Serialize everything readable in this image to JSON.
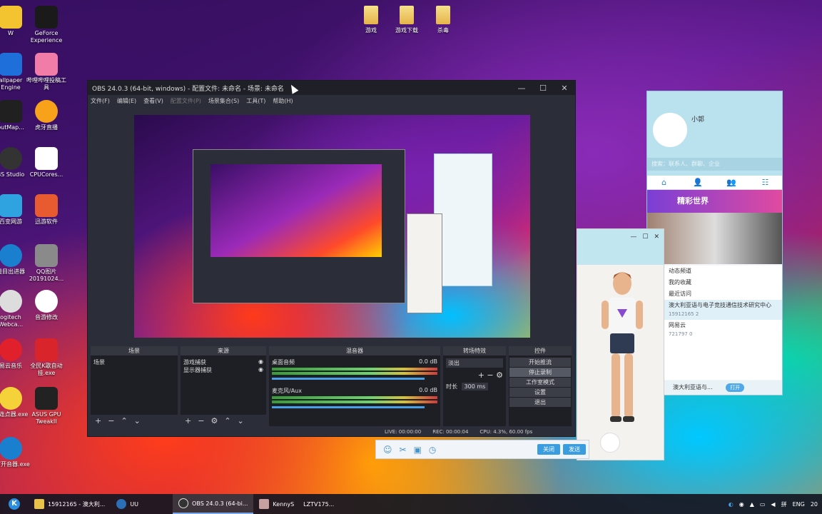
{
  "desktop": {
    "left_icons": [
      {
        "label": "W"
      },
      {
        "label": "GeForce Experience"
      },
      {
        "label": "allpaper Engine"
      },
      {
        "label": "哔哩哔哩投稿工具"
      },
      {
        "label": "putMap..."
      },
      {
        "label": "虎牙直播"
      },
      {
        "label": "BS Studio"
      },
      {
        "label": "CPUCores..."
      },
      {
        "label": "百变网游"
      },
      {
        "label": "迅游软件"
      },
      {
        "label": "最目出进器"
      },
      {
        "label": "QQ图片20191024..."
      },
      {
        "label": "ogitech Webca..."
      },
      {
        "label": "音游修改"
      },
      {
        "label": "易云音乐"
      },
      {
        "label": "全民K歌自动挂.exe"
      },
      {
        "label": "标连点器.exe"
      },
      {
        "label": "ASUS GPU TweakII"
      },
      {
        "label": "P打开音器.exe"
      }
    ],
    "top_folders": [
      {
        "label": "游戏"
      },
      {
        "label": "游戏下载"
      },
      {
        "label": "杀毒"
      }
    ]
  },
  "obs": {
    "title": "OBS 24.0.3 (64-bit, windows) - 配置文件: 未命名 - 场景: 未命名",
    "controls": [
      "—",
      "☐",
      "✕"
    ],
    "menu": [
      "文件(F)",
      "编辑(E)",
      "查看(V)",
      "配置文件(P)",
      "场景集合(S)",
      "工具(T)",
      "帮助(H)"
    ],
    "panels": {
      "scenes": {
        "title": "场景",
        "items": [
          "场景"
        ]
      },
      "sources": {
        "title": "来源",
        "items": [
          "游戏捕获",
          "显示器捕获"
        ]
      },
      "mixer": {
        "title": "混音器",
        "tracks": [
          {
            "name": "桌面音频",
            "db": "0.0 dB"
          },
          {
            "name": "麦克风/Aux",
            "db": "0.0 dB"
          }
        ]
      },
      "transitions": {
        "title": "转场特效",
        "type": "淡出",
        "duration_label": "时长",
        "duration_value": "300 ms"
      },
      "controls": {
        "title": "控件",
        "buttons": [
          "开始推流",
          "停止录制",
          "工作室模式",
          "设置",
          "退出"
        ]
      }
    },
    "status": {
      "live": "LIVE: 00:00:00",
      "rec": "REC: 00:00:04",
      "cpu": "CPU: 4.3%, 60.00 fps"
    }
  },
  "qq": {
    "nickname": "小郭",
    "search_placeholder": "搜索：联系人、群聊、企业",
    "tabs": [
      "⌂",
      "👤",
      "👥",
      "☷"
    ],
    "banner": "精彩世界",
    "list": [
      {
        "title": "动态频道",
        "sub": ""
      },
      {
        "title": "我的收藏",
        "sub": ""
      },
      {
        "title": "最近访问",
        "sub": ""
      },
      {
        "title": "澳大利亚语与电子竞技通信技术研究中心",
        "sub": "15912165    2"
      },
      {
        "title": "网易云",
        "sub": "721797    0"
      }
    ],
    "bottom_text": "澳大利亚语与...",
    "bottom_button": "打开"
  },
  "bottom_toolbar": {
    "close": "关闭",
    "send": "发送"
  },
  "taskbar": {
    "tasks": [
      {
        "label": "15912165 - 澳大利..."
      },
      {
        "label": "UU"
      },
      {
        "label": "OBS 24.0.3 (64-bi..."
      },
      {
        "label": "KennyS"
      },
      {
        "label": "LZTV175..."
      }
    ],
    "tray": {
      "lang": "ENG",
      "time": "20"
    }
  }
}
